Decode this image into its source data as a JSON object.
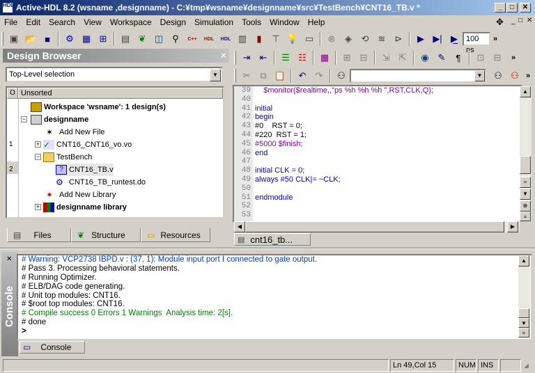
{
  "window": {
    "title": "Active-HDL 8.2 (wsname ,designname) - C:¥tmp¥wsname¥designname¥src¥TestBench¥CNT16_TB.v *",
    "app_icon_text": "HDL"
  },
  "menu": [
    "File",
    "Edit",
    "Search",
    "View",
    "Workspace",
    "Design",
    "Simulation",
    "Tools",
    "Window",
    "Help"
  ],
  "toolbar": {
    "time_value": "100 ns",
    "search_value": ""
  },
  "design_browser": {
    "title": "Design Browser",
    "selection": "Top-Level selection",
    "columns": {
      "o": "O",
      "sort": "Unsorted"
    },
    "tree": [
      {
        "label": "Workspace 'wsname': 1 design(s)",
        "bold": true,
        "num": ""
      },
      {
        "label": "designname",
        "bold": true,
        "num": ""
      },
      {
        "label": "Add New File",
        "bold": false,
        "num": ""
      },
      {
        "label": "CNT16_CNT16_vo.vo",
        "bold": false,
        "num": "1"
      },
      {
        "label": "TestBench",
        "bold": false,
        "num": ""
      },
      {
        "label": "CNT16_TB.v",
        "bold": false,
        "num": "2"
      },
      {
        "label": "CNT16_TB_runtest.do",
        "bold": false,
        "num": ""
      },
      {
        "label": "Add New Library",
        "bold": false,
        "num": ""
      },
      {
        "label": "designname library",
        "bold": true,
        "num": ""
      }
    ],
    "tabs": [
      "Files",
      "Structure",
      "Resources"
    ]
  },
  "editor": {
    "tab": "cnt16_tb...",
    "line_numbers": [
      "39",
      "40",
      "41",
      "42",
      "43",
      "44",
      "45",
      "46",
      "47",
      "48",
      "49",
      "50",
      "51",
      "52",
      "53"
    ],
    "lines": [
      "    $monitor($realtime,,\"ps %h %h %h \",RST,CLK,Q);",
      "",
      "initial",
      "begin",
      "#0    RST = 0;",
      "#220  RST = 1;",
      "#5000 $finish;",
      "end",
      "",
      "initial CLK = 0;",
      "always #50 CLK|= ~CLK;",
      "",
      "endmodule",
      "",
      ""
    ]
  },
  "console": {
    "side_label": "Console",
    "tab": "Console",
    "lines": [
      {
        "text": "# Warning: VCP2738 IBPD.v : (37, 1): Module input port I connected to gate output.",
        "kind": "warn"
      },
      {
        "text": "# Pass 3. Processing behavioral statements.",
        "kind": "normal"
      },
      {
        "text": "# Running Optimizer.",
        "kind": "normal"
      },
      {
        "text": "# ELB/DAG code generating.",
        "kind": "normal"
      },
      {
        "text": "# Unit top modules: CNT16.",
        "kind": "normal"
      },
      {
        "text": "# $root top modules: CNT16.",
        "kind": "normal"
      },
      {
        "text": "# Compile success 0 Errors 1 Warnings  Analysis time: 2[s].",
        "kind": "ok"
      },
      {
        "text": "# done",
        "kind": "normal"
      }
    ],
    "prompt": ">"
  },
  "status": {
    "position": "Ln 49,Col 15",
    "num": "NUM",
    "ins": "INS"
  }
}
